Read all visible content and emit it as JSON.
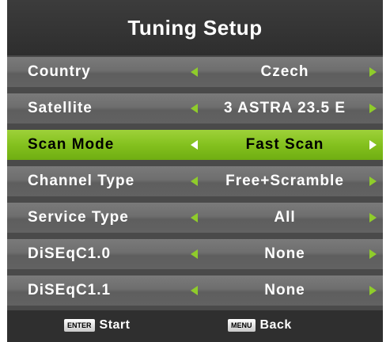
{
  "title": "Tuning Setup",
  "rows": [
    {
      "label": "Country",
      "value": "Czech"
    },
    {
      "label": "Satellite",
      "value": "3 ASTRA 23.5 E"
    },
    {
      "label": "Scan Mode",
      "value": "Fast Scan"
    },
    {
      "label": "Channel Type",
      "value": "Free+Scramble"
    },
    {
      "label": "Service Type",
      "value": "All"
    },
    {
      "label": "DiSEqC1.0",
      "value": "None"
    },
    {
      "label": "DiSEqC1.1",
      "value": "None"
    }
  ],
  "selected_row": "Scan Mode",
  "footer": {
    "enter_key": "ENTER",
    "enter_label": "Start",
    "menu_key": "MENU",
    "menu_label": "Back"
  },
  "colors": {
    "highlight": "#84c11e",
    "arrow": "#8fcc2b",
    "row_bg": "#6e6e6e",
    "title_bg": "#333333"
  }
}
